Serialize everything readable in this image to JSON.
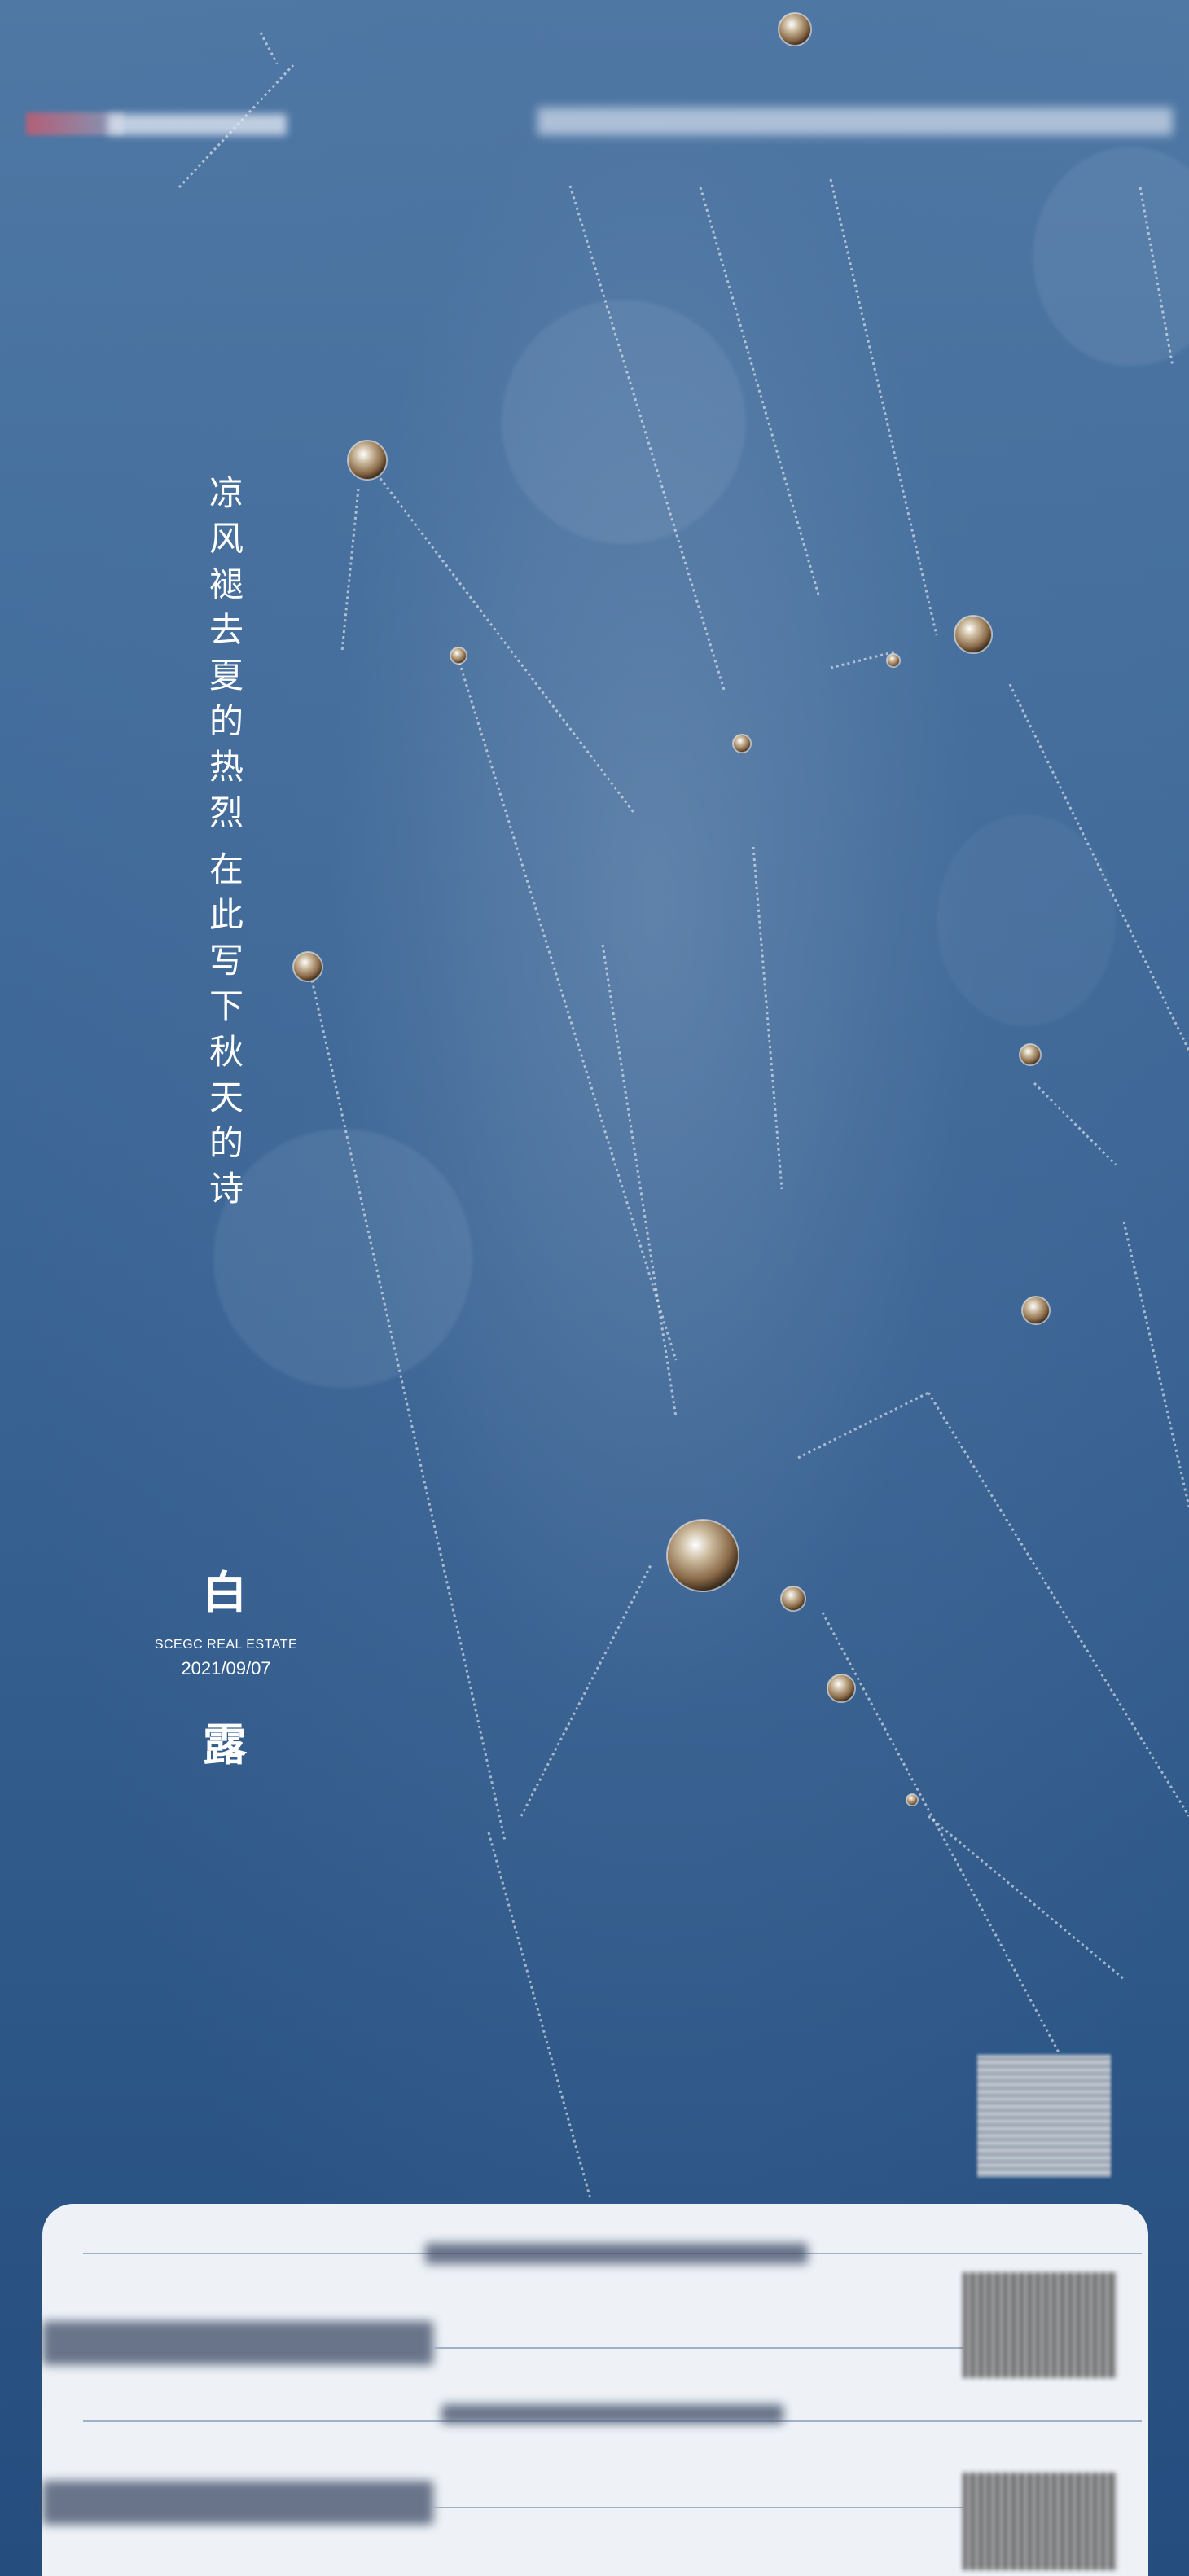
{
  "poster": {
    "poem_line_1": [
      "凉",
      "风",
      "褪",
      "去",
      "夏",
      "的",
      "热",
      "烈"
    ],
    "poem_line_2": [
      "在",
      "此",
      "写",
      "下",
      "秋",
      "天",
      "的",
      "诗"
    ],
    "solar_term_char_1": "白",
    "solar_term_char_2": "露",
    "brand": "SCEGC REAL ESTATE",
    "date": "2021/09/07"
  },
  "colors": {
    "sky_top": "#4f78a5",
    "sky_bottom": "#254d7e",
    "text": "#ffffff",
    "card": "#eef2f7"
  }
}
